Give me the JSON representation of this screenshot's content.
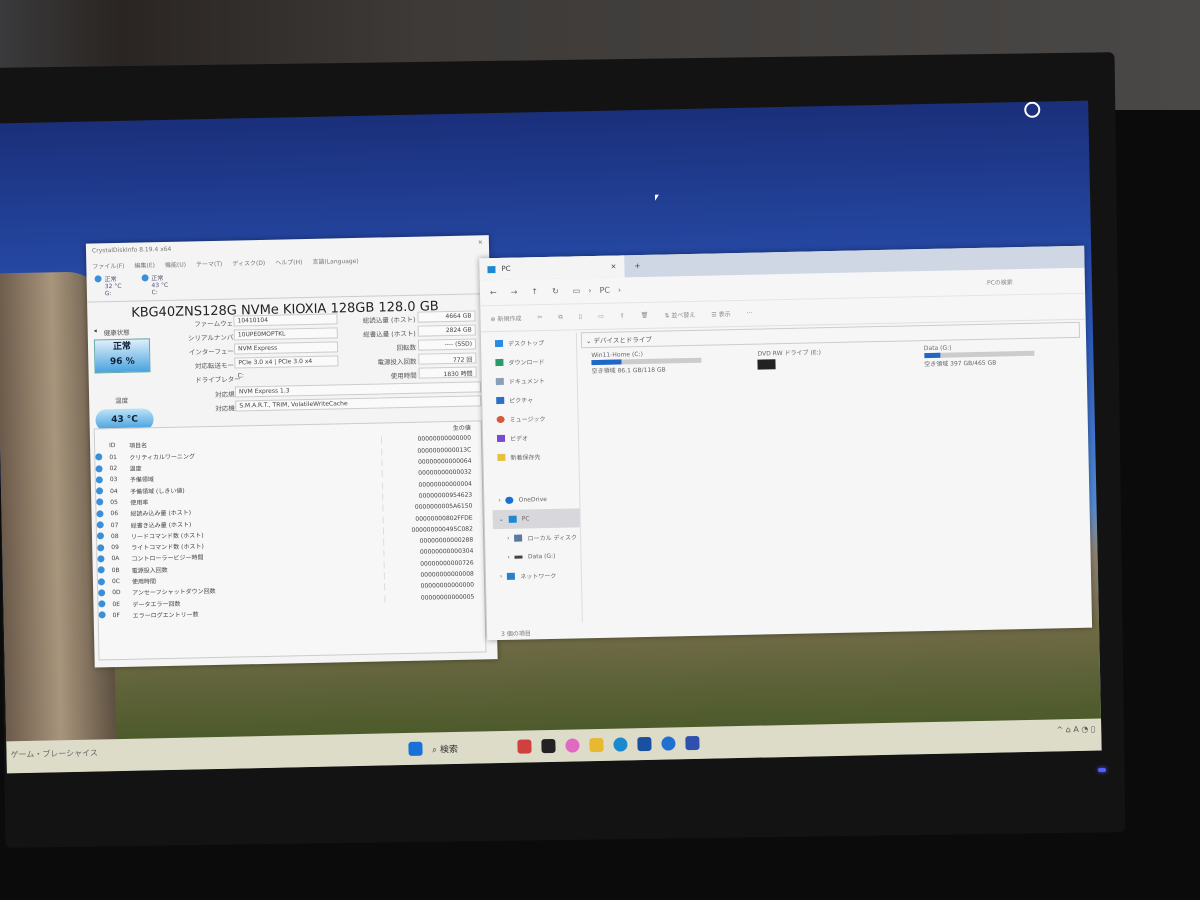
{
  "cdi": {
    "title": "CrystalDiskInfo 8.19.4 x64",
    "menu": [
      "ファイル(F)",
      "編集(E)",
      "機能(U)",
      "テーマ(T)",
      "ディスク(D)",
      "ヘルプ(H)",
      "言語(Language)"
    ],
    "disks": [
      {
        "status": "正常",
        "temp": "32 °C",
        "letter": "G:"
      },
      {
        "status": "正常",
        "temp": "43 °C",
        "letter": "C:"
      }
    ],
    "model": "KBG40ZNS128G NVMe KIOXIA 128GB 128.0 GB",
    "health_label": "健康状態",
    "health_status": "正常",
    "health_percent": "96 %",
    "temp_label": "温度",
    "temp_value": "43 °C",
    "firmware_label": "ファームウェア",
    "firmware": "10410104",
    "serial_label": "シリアルナンバー",
    "serial": "10UPE0MOPTKL",
    "interface_label": "インターフェース",
    "interface": "NVM Express",
    "transfer_label": "対応転送モード",
    "transfer": "PCIe 3.0 x4 | PCIe 3.0 x4",
    "drive_label": "ドライブレター",
    "drive": "C:",
    "standard_label": "対応規格",
    "standard": "NVM Express 1.3",
    "features_label": "対応機能",
    "features": "S.M.A.R.T., TRIM, VolatileWriteCache",
    "reads_label": "総読込量 (ホスト)",
    "reads": "4664 GB",
    "writes_label": "総書込量 (ホスト)",
    "writes": "2824 GB",
    "rpm_label": "回転数",
    "rpm": "---- (SSD)",
    "power_count_label": "電源投入回数",
    "power_count": "772 回",
    "hours_label": "使用時間",
    "hours": "1830 時間",
    "table_headers": [
      "ID",
      "項目名",
      "生の値"
    ],
    "rows": [
      {
        "id": "",
        "name": "",
        "raw": "00000000000000"
      },
      {
        "id": "01",
        "name": "クリティカルワーニング",
        "raw": "0000000000013C"
      },
      {
        "id": "02",
        "name": "温度",
        "raw": "00000000000064"
      },
      {
        "id": "03",
        "name": "予備領域",
        "raw": "00000000000032"
      },
      {
        "id": "04",
        "name": "予備領域 (しきい値)",
        "raw": "00000000000004"
      },
      {
        "id": "05",
        "name": "使用率",
        "raw": "00000000954623"
      },
      {
        "id": "06",
        "name": "総読み込み量 (ホスト)",
        "raw": "0000000005A6150"
      },
      {
        "id": "07",
        "name": "総書き込み量 (ホスト)",
        "raw": "00000000802FFDE"
      },
      {
        "id": "08",
        "name": "リードコマンド数 (ホスト)",
        "raw": "000000000495C082"
      },
      {
        "id": "09",
        "name": "ライトコマンド数 (ホスト)",
        "raw": "00000000000288"
      },
      {
        "id": "0A",
        "name": "コントローラービジー時間",
        "raw": "00000000000304"
      },
      {
        "id": "0B",
        "name": "電源投入回数",
        "raw": "00000000000726"
      },
      {
        "id": "0C",
        "name": "使用時間",
        "raw": "00000000000008"
      },
      {
        "id": "0D",
        "name": "アンセーフシャットダウン回数",
        "raw": "00000000000000"
      },
      {
        "id": "0E",
        "name": "データエラー回数",
        "raw": "00000000000005"
      },
      {
        "id": "0F",
        "name": "エラーログエントリー数",
        "raw": ""
      }
    ]
  },
  "explorer": {
    "tab": "PC",
    "close": "×",
    "new_tab": "+",
    "address": "PC",
    "search": "PCの検索",
    "new": "新規作成",
    "sort": "並べ替え",
    "view": "表示",
    "more": "···",
    "section": "デバイスとドライブ",
    "quick": [
      "デスクトップ",
      "ダウンロード",
      "ドキュメント",
      "ピクチャ",
      "ミュージック",
      "ビデオ",
      "新着保存先"
    ],
    "tree": [
      "OneDrive",
      "PC",
      "ローカル ディスク",
      "Data (G:)",
      "ネットワーク"
    ],
    "drives": [
      {
        "name": "Win11-Home (C:)",
        "free": "空き領域 86.1 GB/118 GB",
        "used": 0.27
      },
      {
        "name": "DVD RW ドライブ (E:)",
        "free": "",
        "used": null
      },
      {
        "name": "Data (G:)",
        "free": "空き領域 397 GB/465 GB",
        "used": 0.15
      }
    ],
    "status": "3 個の項目"
  },
  "taskbar": {
    "search": "検索",
    "left": "ゲーム・ブレーシャイス"
  }
}
